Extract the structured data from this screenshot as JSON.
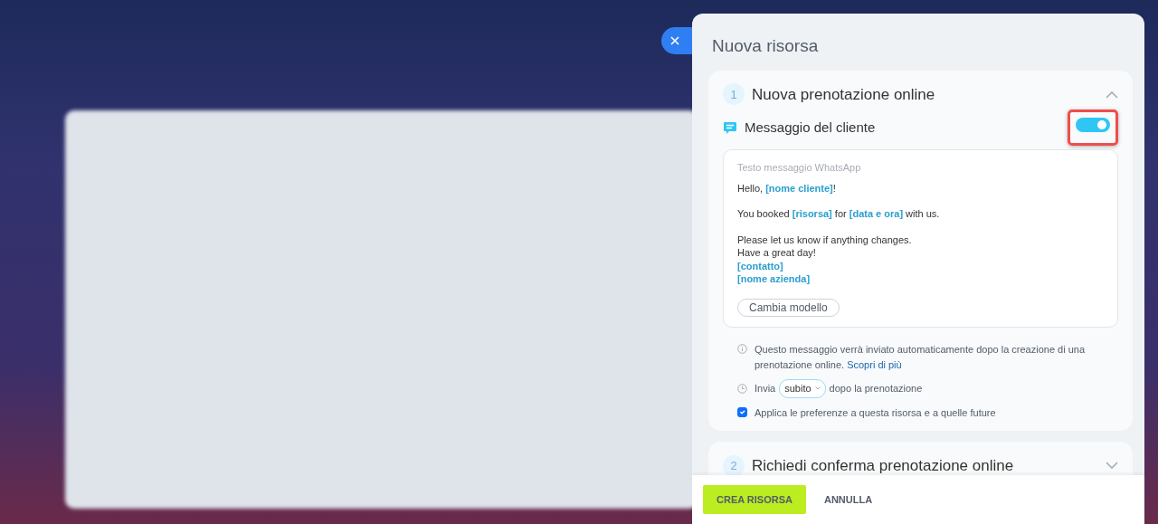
{
  "panel": {
    "title": "Nuova risorsa"
  },
  "sections": [
    {
      "number": "1",
      "title": "Nuova prenotazione online",
      "expanded": true,
      "message": {
        "label": "Messaggio del cliente",
        "on": true,
        "highlighted": true,
        "editor_label": "Testo messaggio WhatsApp",
        "paragraphs": [
          [
            [
              {
                "kind": "text",
                "text": "Hello, "
              },
              {
                "kind": "token",
                "text": "[nome cliente]"
              },
              {
                "kind": "text",
                "text": "!"
              }
            ]
          ],
          [
            [
              {
                "kind": "text",
                "text": "You booked "
              },
              {
                "kind": "token",
                "text": "[risorsa]"
              },
              {
                "kind": "text",
                "text": " for "
              },
              {
                "kind": "token",
                "text": "[data e ora]"
              },
              {
                "kind": "text",
                "text": " with us."
              }
            ]
          ],
          [
            [
              {
                "kind": "text",
                "text": "Please let us know if anything changes."
              }
            ],
            [
              {
                "kind": "text",
                "text": "Have a great day!"
              }
            ],
            [
              {
                "kind": "token",
                "text": "[contatto]"
              }
            ],
            [
              {
                "kind": "token",
                "text": "[nome azienda]"
              }
            ]
          ]
        ],
        "template_button": "Cambia modello"
      },
      "info": {
        "text": "Questo messaggio verrà inviato automaticamente dopo la creazione di una prenotazione online.",
        "link": "Scopri di più"
      },
      "send": {
        "before": "Invia",
        "value": "subito",
        "after": "dopo la prenotazione"
      },
      "apply": {
        "label": "Applica le preferenze a questa risorsa e a quelle future",
        "checked": true
      }
    },
    {
      "number": "2",
      "title": "Richiedi conferma prenotazione online",
      "expanded": false
    }
  ],
  "footer": {
    "buttons": [
      {
        "kind": "primary",
        "label": "CREA RISORSA"
      },
      {
        "kind": "link",
        "label": "ANNULLA"
      }
    ]
  }
}
